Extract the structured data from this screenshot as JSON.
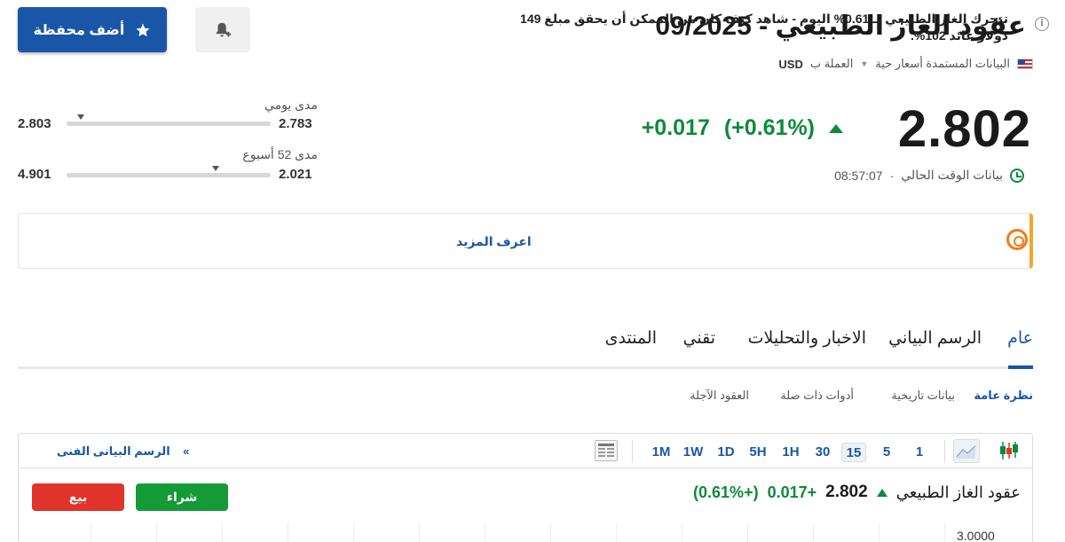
{
  "header": {
    "title": "عقود الغاز الطبيعي - 09/2025",
    "info_icon": "info-icon",
    "meta_data_source": "البيانات المستمدة أسعار حية",
    "meta_currency_label": "العملة ب",
    "meta_currency": "USD",
    "add_portfolio_label": "أضف محفظة",
    "alert_icon": "bell-plus-icon"
  },
  "quote": {
    "price": "2.802",
    "change": "+0.017",
    "change_pct": "(+0.61%)",
    "time_label": "بيانات الوقت الحالي",
    "time_value": "08:57:07"
  },
  "ranges": {
    "daily": {
      "label": "مدى يومي",
      "low": "2.783",
      "high": "2.803",
      "position": 0.93
    },
    "week52": {
      "label": "مدى 52 أسبوع",
      "low": "2.021",
      "high": "4.901",
      "position": 0.27
    }
  },
  "banner": {
    "text": "تتحرك الغاز الطبيعي بـ 0.61% اليوم - شاهد كيف كان من الممكن أن يحقق مبلغ 149 دولار عائد 102%.",
    "link": "اعرف المزيد"
  },
  "tabs": [
    {
      "label": "عام"
    },
    {
      "label": "الرسم البياني"
    },
    {
      "label": "الاخبار والتحليلات"
    },
    {
      "label": "تقني"
    },
    {
      "label": "المنتدى"
    }
  ],
  "subtabs": [
    {
      "label": "نظرة عامة"
    },
    {
      "label": "بيانات تاريخية"
    },
    {
      "label": "أدوات ذات صلة"
    },
    {
      "label": "العقود الآجلة"
    }
  ],
  "toolbar": {
    "timeframes": [
      "1",
      "5",
      "15",
      "30",
      "1H",
      "5H",
      "1D",
      "1W",
      "1M"
    ],
    "active_timeframe": "15",
    "tech_chart_link": "الرسم البيانى الفنى",
    "tech_chart_arrow": "»"
  },
  "chart_header": {
    "name": "عقود الغاز الطبيعي",
    "price": "2.802",
    "change": "+0.017",
    "change_pct": "(+0.61%)",
    "buy_label": "شراء",
    "sell_label": "بيع",
    "y_label_top": "3.0000"
  },
  "colors": {
    "accent": "#1a56a8",
    "positive": "#0e8a3a",
    "buy": "#159a38",
    "sell": "#e0332a",
    "banner_border": "#f5a623"
  }
}
